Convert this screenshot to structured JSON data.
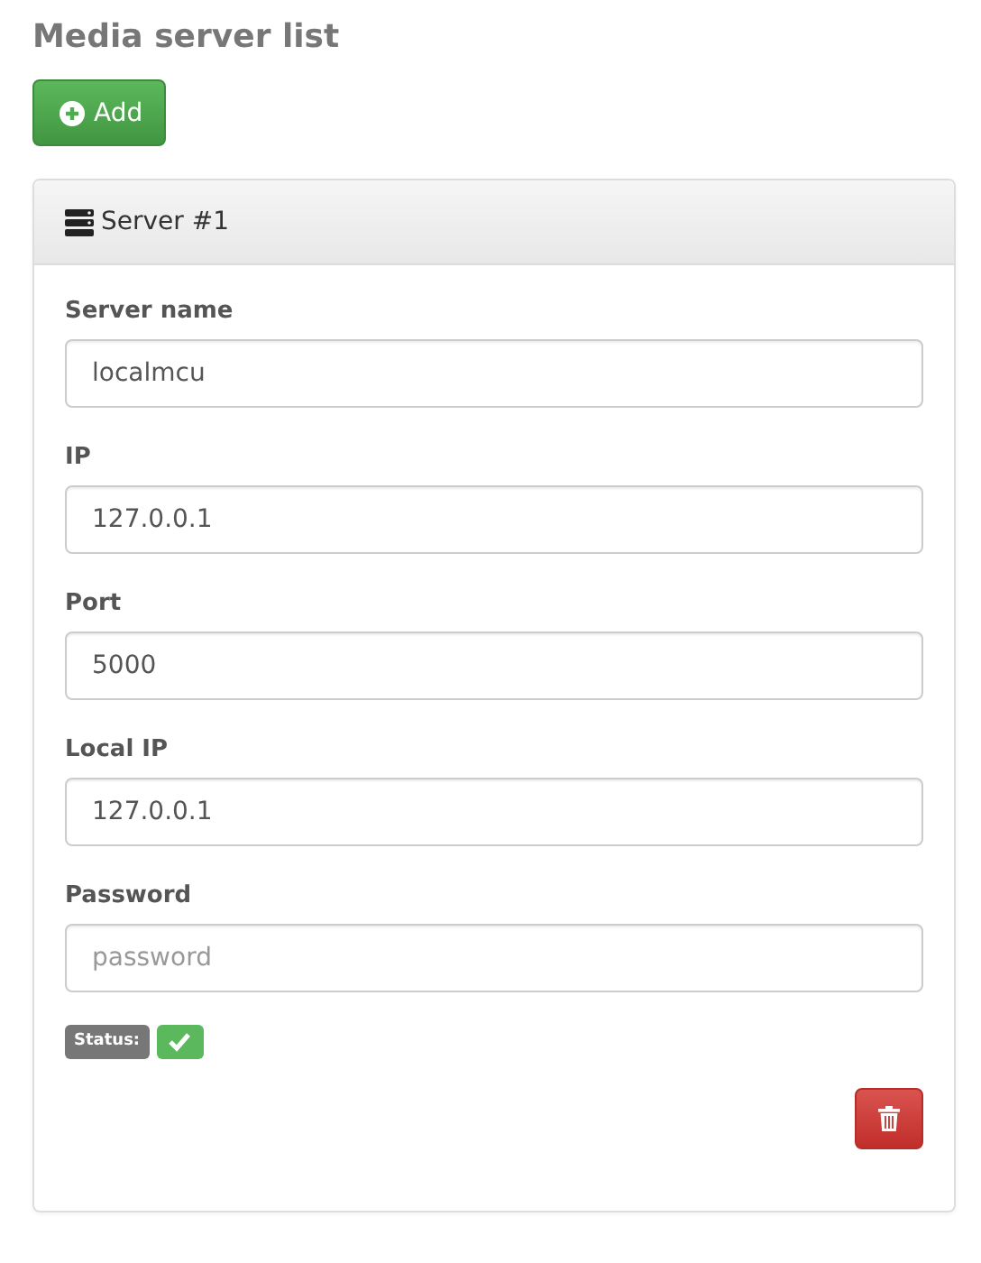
{
  "title": "Media server list",
  "add_button": {
    "label": "Add"
  },
  "servers": [
    {
      "title": "Server #1",
      "fields": [
        {
          "label": "Server name",
          "value": "localmcu"
        },
        {
          "label": "IP",
          "value": "127.0.0.1"
        },
        {
          "label": "Port",
          "value": "5000"
        },
        {
          "label": "Local IP",
          "value": "127.0.0.1"
        },
        {
          "label": "Password",
          "placeholder": "password"
        }
      ],
      "status": {
        "label": "Status:",
        "ok": true
      }
    }
  ]
}
